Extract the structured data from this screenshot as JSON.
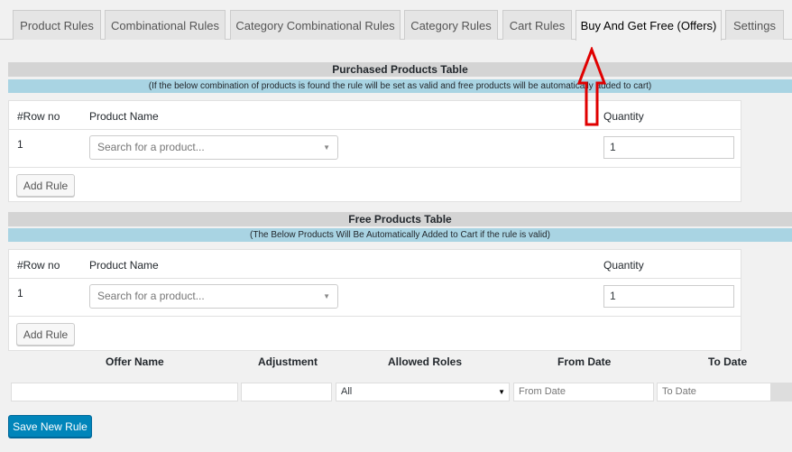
{
  "tabs": [
    {
      "label": "Product Rules",
      "active": false
    },
    {
      "label": "Combinational Rules",
      "active": false
    },
    {
      "label": "Category Combinational Rules",
      "active": false
    },
    {
      "label": "Category Rules",
      "active": false
    },
    {
      "label": "Cart Rules",
      "active": false
    },
    {
      "label": "Buy And Get Free (Offers)",
      "active": true
    },
    {
      "label": "Settings",
      "active": false
    }
  ],
  "purchased": {
    "title": "Purchased Products Table",
    "note": "(If the below combination of products is found the rule will be set as valid and free products will be automatically added to cart)",
    "col_row": "#Row no",
    "col_product": "Product Name",
    "col_qty": "Quantity",
    "row_no": "1",
    "product_placeholder": "Search for a product...",
    "qty_value": "1",
    "add_rule_label": "Add Rule"
  },
  "free": {
    "title": "Free Products Table",
    "note": "(The Below Products Will Be Automatically Added to Cart if the rule is valid)",
    "col_row": "#Row no",
    "col_product": "Product Name",
    "col_qty": "Quantity",
    "row_no": "1",
    "product_placeholder": "Search for a product...",
    "qty_value": "1",
    "add_rule_label": "Add Rule"
  },
  "offer": {
    "offer_name_label": "Offer Name",
    "adjustment_label": "Adjustment",
    "allowed_roles_label": "Allowed Roles",
    "from_date_label": "From Date",
    "to_date_label": "To Date",
    "offer_name_value": "",
    "adjustment_value": "",
    "roles_selected": "All",
    "from_date_placeholder": "From Date",
    "to_date_placeholder": "To Date",
    "save_label": "Save New Rule"
  },
  "colors": {
    "accent": "#0085ba",
    "header_gray": "#d4d4d4",
    "note_blue": "#a9d4e3",
    "annotation_red": "#e00000"
  }
}
